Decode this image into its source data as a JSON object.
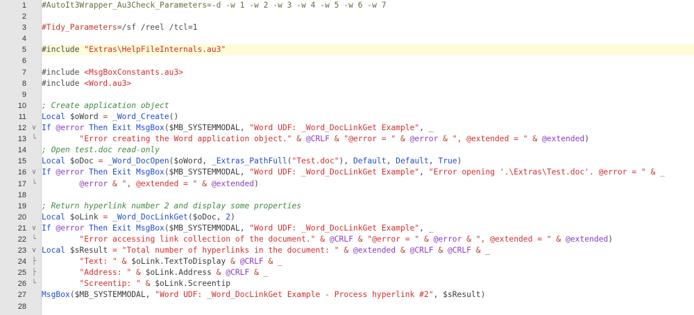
{
  "editor": {
    "current_line": 5,
    "fold_markers": {
      "down": "∨",
      "branch": "├",
      "end": "└"
    },
    "lines": [
      {
        "n": "1",
        "fold": "",
        "tokens": [
          {
            "t": "c",
            "v": "#AutoIt3Wrapper_Au3Check_Parameters=-d -w 1 -w 2 -w 3 -w 4 -w 5 -w 6 -w 7"
          }
        ]
      },
      {
        "n": "2",
        "fold": "",
        "tokens": []
      },
      {
        "n": "3",
        "fold": "",
        "tokens": [
          {
            "t": "p",
            "v": "#Tidy_Parameters"
          },
          {
            "t": "t",
            "v": "=/sf /reel /tcl=1"
          }
        ]
      },
      {
        "n": "4",
        "fold": "",
        "tokens": []
      },
      {
        "n": "5",
        "fold": "",
        "tokens": [
          {
            "t": "t",
            "v": "#include "
          },
          {
            "t": "s",
            "v": "\"Extras\\HelpFileInternals.au3\""
          }
        ]
      },
      {
        "n": "6",
        "fold": "",
        "tokens": []
      },
      {
        "n": "7",
        "fold": "",
        "tokens": [
          {
            "t": "t",
            "v": "#include "
          },
          {
            "t": "s",
            "v": "<MsgBoxConstants.au3>"
          }
        ]
      },
      {
        "n": "8",
        "fold": "",
        "tokens": [
          {
            "t": "t",
            "v": "#include "
          },
          {
            "t": "s",
            "v": "<Word.au3>"
          }
        ]
      },
      {
        "n": "9",
        "fold": "",
        "tokens": []
      },
      {
        "n": "10",
        "fold": "",
        "tokens": [
          {
            "t": "ci",
            "v": "; Create application object"
          }
        ]
      },
      {
        "n": "11",
        "fold": "",
        "tokens": [
          {
            "t": "k",
            "v": "Local "
          },
          {
            "t": "v",
            "v": "$oWord "
          },
          {
            "t": "o",
            "v": "= "
          },
          {
            "t": "f",
            "v": "_Word_Create"
          },
          {
            "t": "x",
            "v": "()"
          }
        ]
      },
      {
        "n": "12",
        "fold": "down",
        "tokens": [
          {
            "t": "k",
            "v": "If "
          },
          {
            "t": "m",
            "v": "@error "
          },
          {
            "t": "k",
            "v": "Then Exit "
          },
          {
            "t": "f",
            "v": "MsgBox"
          },
          {
            "t": "x",
            "v": "("
          },
          {
            "t": "v",
            "v": "$MB_SYSTEMMODAL"
          },
          {
            "t": "x",
            "v": ", "
          },
          {
            "t": "s",
            "v": "\"Word UDF: _Word_DocLinkGet Example\""
          },
          {
            "t": "x",
            "v": ", _"
          }
        ]
      },
      {
        "n": "13",
        "fold": "end",
        "tokens": [
          {
            "t": "g",
            "v": "        "
          },
          {
            "t": "s",
            "v": "\"Error creating the Word application object.\""
          },
          {
            "t": "o",
            "v": " & "
          },
          {
            "t": "m",
            "v": "@CRLF"
          },
          {
            "t": "o",
            "v": " & "
          },
          {
            "t": "s",
            "v": "\"@error = \""
          },
          {
            "t": "o",
            "v": " & "
          },
          {
            "t": "m",
            "v": "@error"
          },
          {
            "t": "o",
            "v": " & "
          },
          {
            "t": "s",
            "v": "\", @extended = \""
          },
          {
            "t": "o",
            "v": " & "
          },
          {
            "t": "m",
            "v": "@extended"
          },
          {
            "t": "x",
            "v": ")"
          }
        ]
      },
      {
        "n": "14",
        "fold": "",
        "tokens": [
          {
            "t": "ci",
            "v": "; Open test.doc read-only"
          }
        ]
      },
      {
        "n": "15",
        "fold": "",
        "tokens": [
          {
            "t": "k",
            "v": "Local "
          },
          {
            "t": "v",
            "v": "$oDoc "
          },
          {
            "t": "o",
            "v": "= "
          },
          {
            "t": "f",
            "v": "_Word_DocOpen"
          },
          {
            "t": "x",
            "v": "("
          },
          {
            "t": "v",
            "v": "$oWord"
          },
          {
            "t": "x",
            "v": ", "
          },
          {
            "t": "f",
            "v": "_Extras_PathFull"
          },
          {
            "t": "x",
            "v": "("
          },
          {
            "t": "s",
            "v": "\"Test.doc\""
          },
          {
            "t": "x",
            "v": "), "
          },
          {
            "t": "k",
            "v": "Default"
          },
          {
            "t": "x",
            "v": ", "
          },
          {
            "t": "k",
            "v": "Default"
          },
          {
            "t": "x",
            "v": ", "
          },
          {
            "t": "k",
            "v": "True"
          },
          {
            "t": "x",
            "v": ")"
          }
        ]
      },
      {
        "n": "16",
        "fold": "down",
        "tokens": [
          {
            "t": "k",
            "v": "If "
          },
          {
            "t": "m",
            "v": "@error "
          },
          {
            "t": "k",
            "v": "Then Exit "
          },
          {
            "t": "f",
            "v": "MsgBox"
          },
          {
            "t": "x",
            "v": "("
          },
          {
            "t": "v",
            "v": "$MB_SYSTEMMODAL"
          },
          {
            "t": "x",
            "v": ", "
          },
          {
            "t": "s",
            "v": "\"Word UDF: _Word_DocLinkGet Example\""
          },
          {
            "t": "x",
            "v": ", "
          },
          {
            "t": "s",
            "v": "\"Error opening '.\\Extras\\Test.doc'. @error = \""
          },
          {
            "t": "o",
            "v": " & _"
          }
        ]
      },
      {
        "n": "17",
        "fold": "end",
        "tokens": [
          {
            "t": "g",
            "v": "        "
          },
          {
            "t": "m",
            "v": "@error"
          },
          {
            "t": "o",
            "v": " & "
          },
          {
            "t": "s",
            "v": "\", @extended = \""
          },
          {
            "t": "o",
            "v": " & "
          },
          {
            "t": "m",
            "v": "@extended"
          },
          {
            "t": "x",
            "v": ")"
          }
        ]
      },
      {
        "n": "18",
        "fold": "",
        "tokens": []
      },
      {
        "n": "19",
        "fold": "",
        "tokens": [
          {
            "t": "ci",
            "v": "; Return hyperlink number 2 and display some properties"
          }
        ]
      },
      {
        "n": "20",
        "fold": "",
        "tokens": [
          {
            "t": "k",
            "v": "Local "
          },
          {
            "t": "v",
            "v": "$oLink "
          },
          {
            "t": "o",
            "v": "= "
          },
          {
            "t": "f",
            "v": "_Word_DocLinkGet"
          },
          {
            "t": "x",
            "v": "("
          },
          {
            "t": "v",
            "v": "$oDoc"
          },
          {
            "t": "x",
            "v": ", "
          },
          {
            "t": "n",
            "v": "2"
          },
          {
            "t": "x",
            "v": ")"
          }
        ]
      },
      {
        "n": "21",
        "fold": "down",
        "tokens": [
          {
            "t": "k",
            "v": "If "
          },
          {
            "t": "m",
            "v": "@error "
          },
          {
            "t": "k",
            "v": "Then Exit "
          },
          {
            "t": "f",
            "v": "MsgBox"
          },
          {
            "t": "x",
            "v": "("
          },
          {
            "t": "v",
            "v": "$MB_SYSTEMMODAL"
          },
          {
            "t": "x",
            "v": ", "
          },
          {
            "t": "s",
            "v": "\"Word UDF: _Word_DocLinkGet Example\""
          },
          {
            "t": "x",
            "v": ", _"
          }
        ]
      },
      {
        "n": "22",
        "fold": "end",
        "tokens": [
          {
            "t": "g",
            "v": "        "
          },
          {
            "t": "s",
            "v": "\"Error accessing link collection of the document.\""
          },
          {
            "t": "o",
            "v": " & "
          },
          {
            "t": "m",
            "v": "@CRLF"
          },
          {
            "t": "o",
            "v": " & "
          },
          {
            "t": "s",
            "v": "\"@error = \""
          },
          {
            "t": "o",
            "v": " & "
          },
          {
            "t": "m",
            "v": "@error"
          },
          {
            "t": "o",
            "v": " & "
          },
          {
            "t": "s",
            "v": "\", @extended = \""
          },
          {
            "t": "o",
            "v": " & "
          },
          {
            "t": "m",
            "v": "@extended"
          },
          {
            "t": "x",
            "v": ")"
          }
        ]
      },
      {
        "n": "23",
        "fold": "down",
        "tokens": [
          {
            "t": "k",
            "v": "Local "
          },
          {
            "t": "v",
            "v": "$sResult "
          },
          {
            "t": "o",
            "v": "= "
          },
          {
            "t": "s",
            "v": "\"Total number of hyperlinks in the document: \""
          },
          {
            "t": "o",
            "v": " & "
          },
          {
            "t": "m",
            "v": "@extended"
          },
          {
            "t": "o",
            "v": " & "
          },
          {
            "t": "m",
            "v": "@CRLF"
          },
          {
            "t": "o",
            "v": " & "
          },
          {
            "t": "m",
            "v": "@CRLF"
          },
          {
            "t": "o",
            "v": " & _"
          }
        ]
      },
      {
        "n": "24",
        "fold": "branch",
        "tokens": [
          {
            "t": "g",
            "v": "        "
          },
          {
            "t": "s",
            "v": "\"Text: \""
          },
          {
            "t": "o",
            "v": " & "
          },
          {
            "t": "v",
            "v": "$oLink.TextToDisplay"
          },
          {
            "t": "o",
            "v": " & "
          },
          {
            "t": "m",
            "v": "@CRLF"
          },
          {
            "t": "o",
            "v": " & _"
          }
        ]
      },
      {
        "n": "25",
        "fold": "branch",
        "tokens": [
          {
            "t": "g",
            "v": "        "
          },
          {
            "t": "s",
            "v": "\"Address: \""
          },
          {
            "t": "o",
            "v": " & "
          },
          {
            "t": "v",
            "v": "$oLink.Address"
          },
          {
            "t": "o",
            "v": " & "
          },
          {
            "t": "m",
            "v": "@CRLF"
          },
          {
            "t": "o",
            "v": " & _"
          }
        ]
      },
      {
        "n": "26",
        "fold": "end",
        "tokens": [
          {
            "t": "g",
            "v": "        "
          },
          {
            "t": "s",
            "v": "\"Screentip: \""
          },
          {
            "t": "o",
            "v": " & "
          },
          {
            "t": "v",
            "v": "$oLink.Screentip"
          }
        ]
      },
      {
        "n": "27",
        "fold": "",
        "tokens": [
          {
            "t": "f",
            "v": "MsgBox"
          },
          {
            "t": "x",
            "v": "("
          },
          {
            "t": "v",
            "v": "$MB_SYSTEMMODAL"
          },
          {
            "t": "x",
            "v": ", "
          },
          {
            "t": "s",
            "v": "\"Word UDF: _Word_DocLinkGet Example - Process hyperlink #2\""
          },
          {
            "t": "x",
            "v": ", "
          },
          {
            "t": "v",
            "v": "$sResult"
          },
          {
            "t": "x",
            "v": ")"
          }
        ]
      },
      {
        "n": "28",
        "fold": "",
        "tokens": []
      }
    ]
  }
}
